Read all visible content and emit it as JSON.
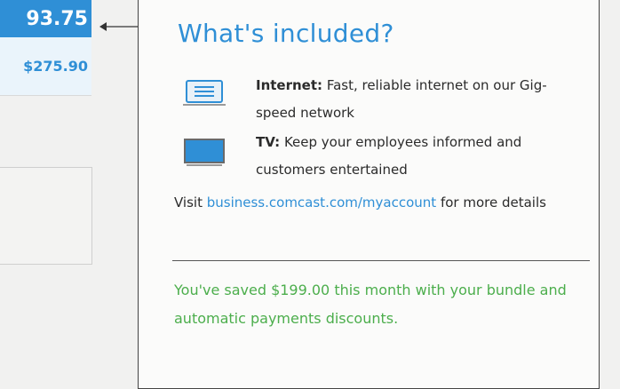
{
  "bill": {
    "amount_due": "93.75",
    "previous_amount": "$275.90"
  },
  "included": {
    "title": "What's included?",
    "features": [
      {
        "icon": "router-icon",
        "name": "Internet:",
        "description": "Fast, reliable internet on our Gig-speed network"
      },
      {
        "icon": "tv-icon",
        "name": "TV:",
        "description": "Keep your employees informed and customers entertained"
      }
    ],
    "visit_prefix": "Visit",
    "visit_link": "business.comcast.com/myaccount",
    "visit_suffix": "for more details",
    "savings": "You've saved $199.00 this month with your bundle and automatic payments discounts."
  },
  "colors": {
    "accent_blue": "#2f8fd6",
    "savings_green": "#4cae4c"
  }
}
